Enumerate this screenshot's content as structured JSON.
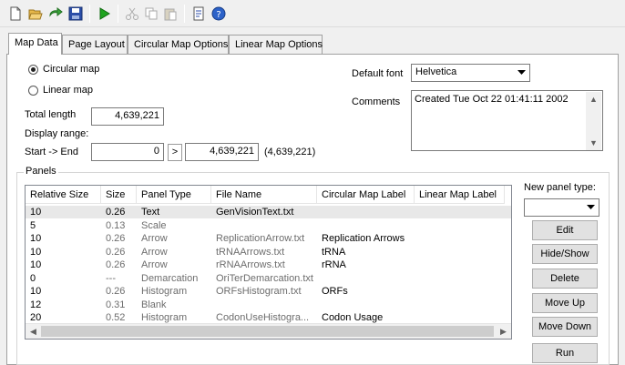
{
  "toolbar": {
    "buttons": [
      "new-icon",
      "open-icon",
      "redo-icon",
      "save-icon",
      "run-icon",
      "cut-icon",
      "copy-icon",
      "paste-icon",
      "properties-icon",
      "help-icon"
    ]
  },
  "tabs": [
    {
      "label": "Map Data",
      "active": true
    },
    {
      "label": "Page Layout",
      "active": false
    },
    {
      "label": "Circular Map Options",
      "active": false
    },
    {
      "label": "Linear Map Options",
      "active": false
    }
  ],
  "map_type": {
    "circular_label": "Circular map",
    "linear_label": "Linear map",
    "selected": "circular"
  },
  "total_length": {
    "label": "Total length",
    "value": "4,639,221"
  },
  "display_range": {
    "label": "Display range:",
    "start_end_label": "Start -> End",
    "start": "0",
    "arrow": ">",
    "end": "4,639,221",
    "note": "(4,639,221)"
  },
  "default_font": {
    "label": "Default font",
    "value": "Helvetica"
  },
  "comments": {
    "label": "Comments",
    "value": "Created Tue Oct 22 01:41:11 2002"
  },
  "panels": {
    "title": "Panels",
    "columns": [
      "Relative Size",
      "Size",
      "Panel Type",
      "File Name",
      "Circular Map Label",
      "Linear Map Label"
    ],
    "rows": [
      {
        "rel": "10",
        "size": "0.26",
        "type": "Text",
        "file": "GenVisionText.txt",
        "circ": "",
        "lin": "",
        "selected": true
      },
      {
        "rel": "5",
        "size": "0.13",
        "type": "Scale",
        "file": "",
        "circ": "",
        "lin": "",
        "selected": false
      },
      {
        "rel": "10",
        "size": "0.26",
        "type": "Arrow",
        "file": "ReplicationArrow.txt",
        "circ": "Replication Arrows",
        "lin": "",
        "selected": false
      },
      {
        "rel": "10",
        "size": "0.26",
        "type": "Arrow",
        "file": "tRNAArrows.txt",
        "circ": "tRNA",
        "lin": "",
        "selected": false
      },
      {
        "rel": "10",
        "size": "0.26",
        "type": "Arrow",
        "file": "rRNAArrows.txt",
        "circ": "rRNA",
        "lin": "",
        "selected": false
      },
      {
        "rel": "0",
        "size": "---",
        "type": "Demarcation",
        "file": "OriTerDemarcation.txt",
        "circ": "",
        "lin": "",
        "selected": false
      },
      {
        "rel": "10",
        "size": "0.26",
        "type": "Histogram",
        "file": "ORFsHistogram.txt",
        "circ": "ORFs",
        "lin": "",
        "selected": false
      },
      {
        "rel": "12",
        "size": "0.31",
        "type": "Blank",
        "file": "",
        "circ": "",
        "lin": "",
        "selected": false
      },
      {
        "rel": "20",
        "size": "0.52",
        "type": "Histogram",
        "file": "CodonUseHistogra...",
        "circ": "Codon Usage",
        "lin": "",
        "selected": false
      }
    ]
  },
  "panel_actions": {
    "new_panel_type_label": "New panel type:",
    "new_panel_type_value": "",
    "edit": "Edit",
    "hide_show": "Hide/Show",
    "delete": "Delete",
    "move_up": "Move Up",
    "move_down": "Move Down",
    "run": "Run"
  },
  "colors": {
    "selected_row": "#e8e8e8",
    "secondary_text": "#6d6d6d"
  }
}
